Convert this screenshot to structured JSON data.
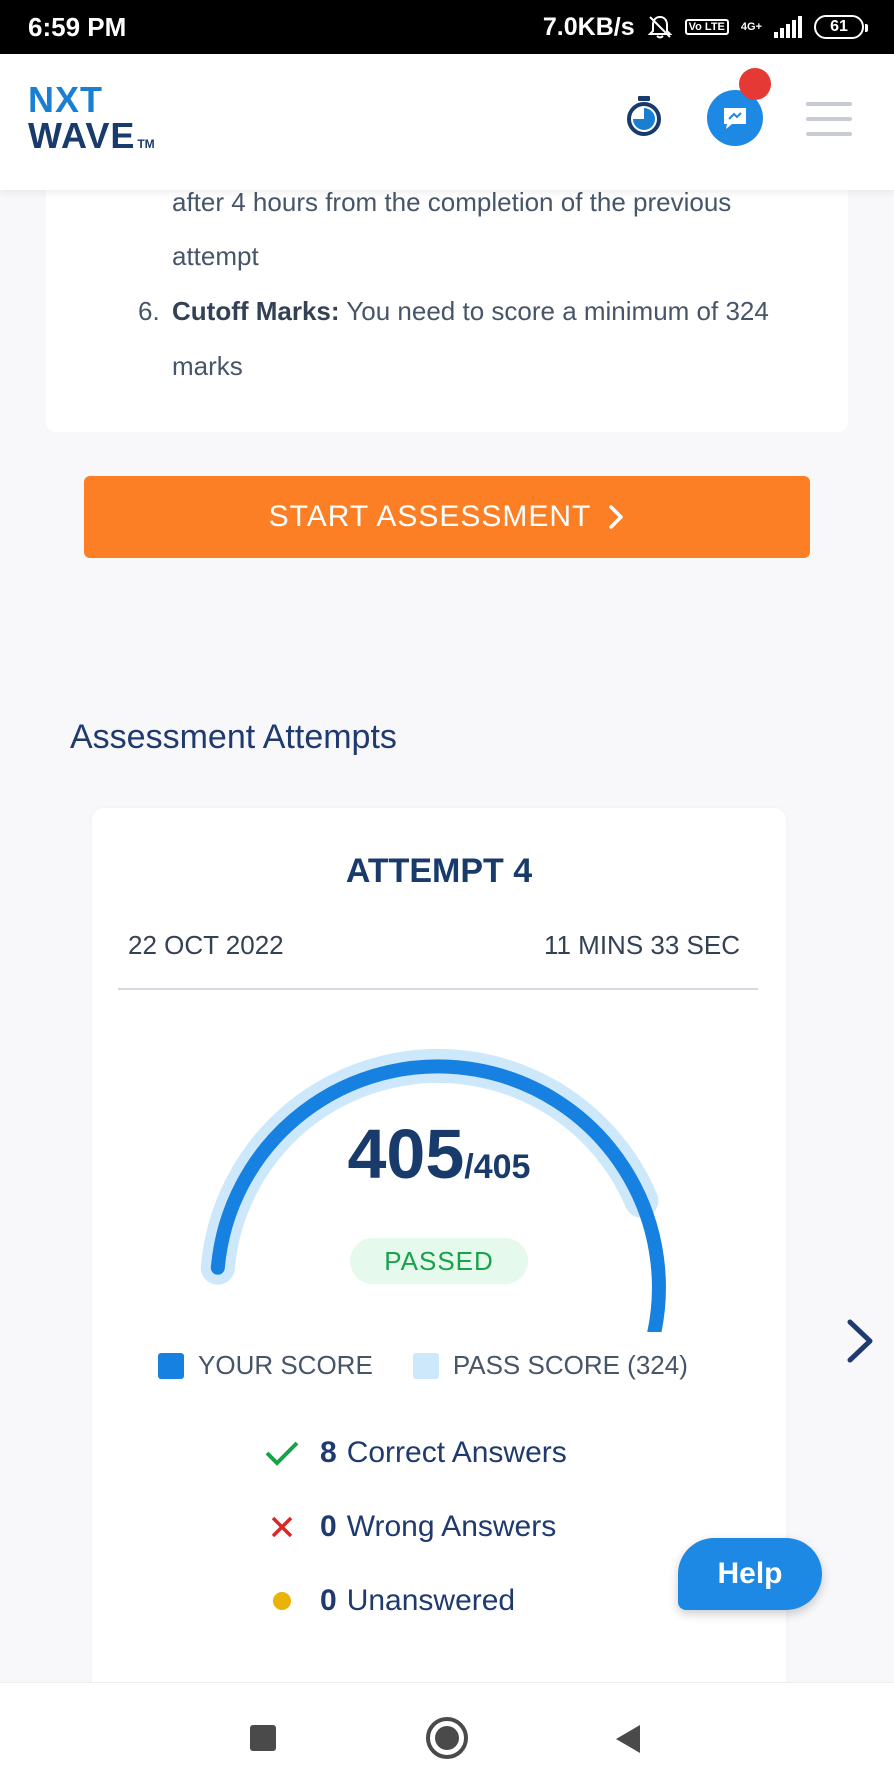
{
  "status_bar": {
    "time": "6:59 PM",
    "speed": "7.0KB/s",
    "volte": "Vo LTE",
    "network": "4G+",
    "battery": "61",
    "icons": [
      "bell-off-icon",
      "signal-icon",
      "battery-icon"
    ]
  },
  "header": {
    "logo_top": "NXT",
    "logo_bottom": "WAVE",
    "logo_tm": "TM",
    "icons": [
      "stopwatch-icon",
      "chat-icon",
      "notification-dot",
      "hamburger-menu-icon"
    ]
  },
  "instructions": {
    "line1": "after 4 hours from the completion of the previous",
    "line2": "attempt",
    "item6_number": "6.",
    "item6_label": "Cutoff Marks:",
    "item6_text": " You need to score a minimum of 324",
    "item6_text2": "marks"
  },
  "start_button": {
    "label": "START ASSESSMENT",
    "icon": "chevron-right-icon"
  },
  "attempts_section": {
    "title": "Assessment Attempts",
    "attempt": {
      "title": "ATTEMPT 4",
      "date": "22 OCT 2022",
      "duration": "11 MINS 33 SEC",
      "score": "405",
      "total": "/405",
      "score_fraction": 1.0,
      "pass_fraction": 0.8,
      "status": "PASSED",
      "legend_your_score": "YOUR SCORE",
      "legend_pass_score": "PASS SCORE (324)",
      "stats": [
        {
          "count": "8",
          "label": " Correct Answers",
          "icon": "check-icon"
        },
        {
          "count": "0",
          "label": " Wrong Answers",
          "icon": "cross-icon"
        },
        {
          "count": "0",
          "label": " Unanswered",
          "icon": "dot-icon"
        }
      ]
    }
  },
  "help_button": {
    "label": "Help"
  },
  "colors": {
    "brand_blue": "#1b7fd1",
    "navy": "#183b6b",
    "orange": "#fd7f25",
    "gauge_fill": "#1681e0",
    "gauge_pass": "#cde8fb",
    "passed_green": "#17a34a"
  }
}
